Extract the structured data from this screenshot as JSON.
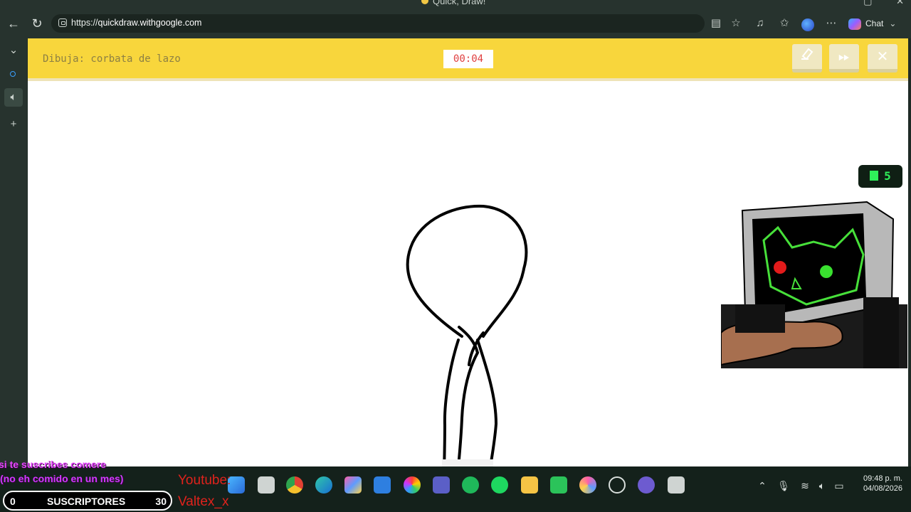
{
  "window": {
    "title": "Quick, Draw!",
    "controls": [
      "▢",
      "✕"
    ]
  },
  "browser": {
    "url_scheme": "https://",
    "url_host": "quickdraw.withgoogle.com",
    "chat_label": "Chat"
  },
  "game": {
    "prompt": "Dibuja: corbata de lazo",
    "timer": "00:04",
    "ai_thinking": "..."
  },
  "overlay": {
    "score": "5",
    "promo_line1": "si te suscribes comere",
    "promo_line2": "(no eh comido en un mes)",
    "platform": "Youtube:",
    "channel": "Valtex_x",
    "subs_min": "0",
    "subs_label": "SUSCRIPTORES",
    "subs_max": "30"
  },
  "taskbar": {
    "time": "09:48 p. m.",
    "date": "04/08/2026"
  },
  "colors": {
    "header_yellow": "#f8d63c",
    "timer_red": "#e04040",
    "score_green": "#2ff05a"
  }
}
